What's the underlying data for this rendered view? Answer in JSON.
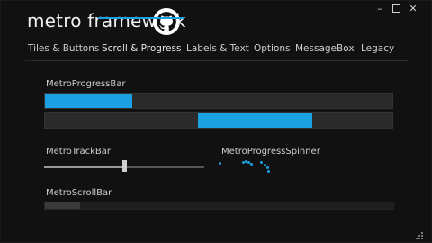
{
  "app": {
    "title": "metro framework"
  },
  "window_buttons": [
    "–",
    "□",
    "✕"
  ],
  "tabs": [
    {
      "label": "Tiles & Buttons",
      "active": false
    },
    {
      "label": "Scroll & Progress",
      "active": true
    },
    {
      "label": "Labels & Text",
      "active": false
    },
    {
      "label": "Options",
      "active": false
    },
    {
      "label": "MessageBox",
      "active": false
    },
    {
      "label": "Legacy",
      "active": false
    }
  ],
  "progress": {
    "label": "MetroProgressBar",
    "bar1_value": 0.25,
    "bar2_marquee_start": 0.44,
    "bar2_marquee_end": 0.77
  },
  "trackbar": {
    "label": "MetroTrackBar",
    "value": 0.5
  },
  "spinner": {
    "label": "MetroProgressSpinner"
  },
  "scrollbar": {
    "label": "MetroScrollBar",
    "thumb_fraction": 0.1
  },
  "colors": {
    "accent": "#1ba1e2",
    "background": "#111111",
    "text": "#cfcfcf"
  }
}
